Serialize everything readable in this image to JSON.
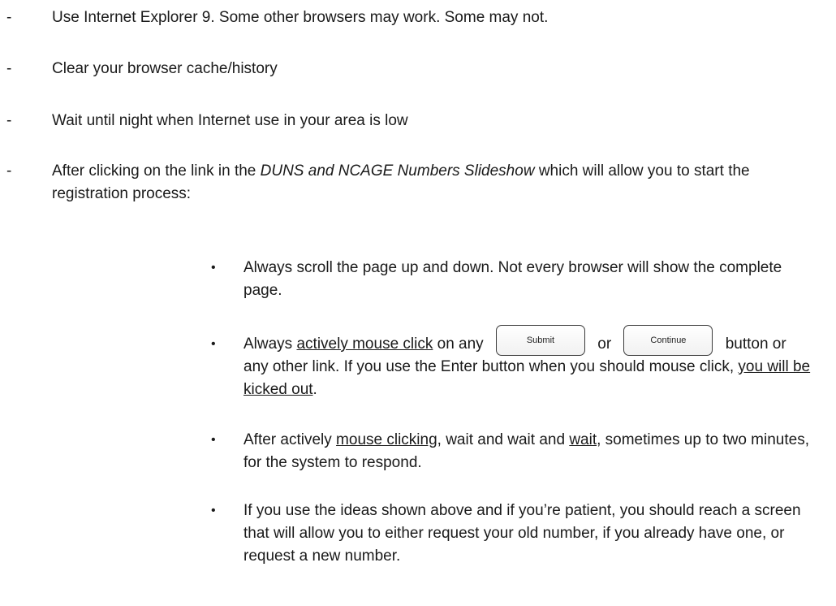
{
  "dash_char": "-",
  "bullet_char": "•",
  "items": {
    "ie": "Use Internet Explorer 9.  Some other browsers may work.  Some may not.",
    "cache": "Clear your browser cache/history",
    "night": "Wait until night when Internet use in your area is low",
    "after_pre": "After clicking on the link in the ",
    "after_italic": "DUNS and NCAGE Numbers Slideshow",
    "after_post": " which will allow you to start the registration process:"
  },
  "bullets": {
    "scroll": "Always scroll the page up and down.  Not every browser will show the complete page.",
    "click_pre": "Always ",
    "click_u1": "actively mouse click",
    "click_mid1": " on any ",
    "submit_label": "Submit",
    "click_or": " or ",
    "continue_label": "Continue",
    "click_mid2": " button or any other link.  If you use the Enter button when you should mouse click, ",
    "click_u2": "you will be kicked out",
    "click_end": ".",
    "wait_pre": "After actively ",
    "wait_u1": "mouse clicking",
    "wait_mid": ", wait and wait and ",
    "wait_u2": "wait",
    "wait_end": ", sometimes up to two minutes, for the system to respond.",
    "patient": "If you use the ideas shown above and if you’re patient, you should reach a screen that will allow you to either request your old number, if you already have one, or request a new number."
  }
}
